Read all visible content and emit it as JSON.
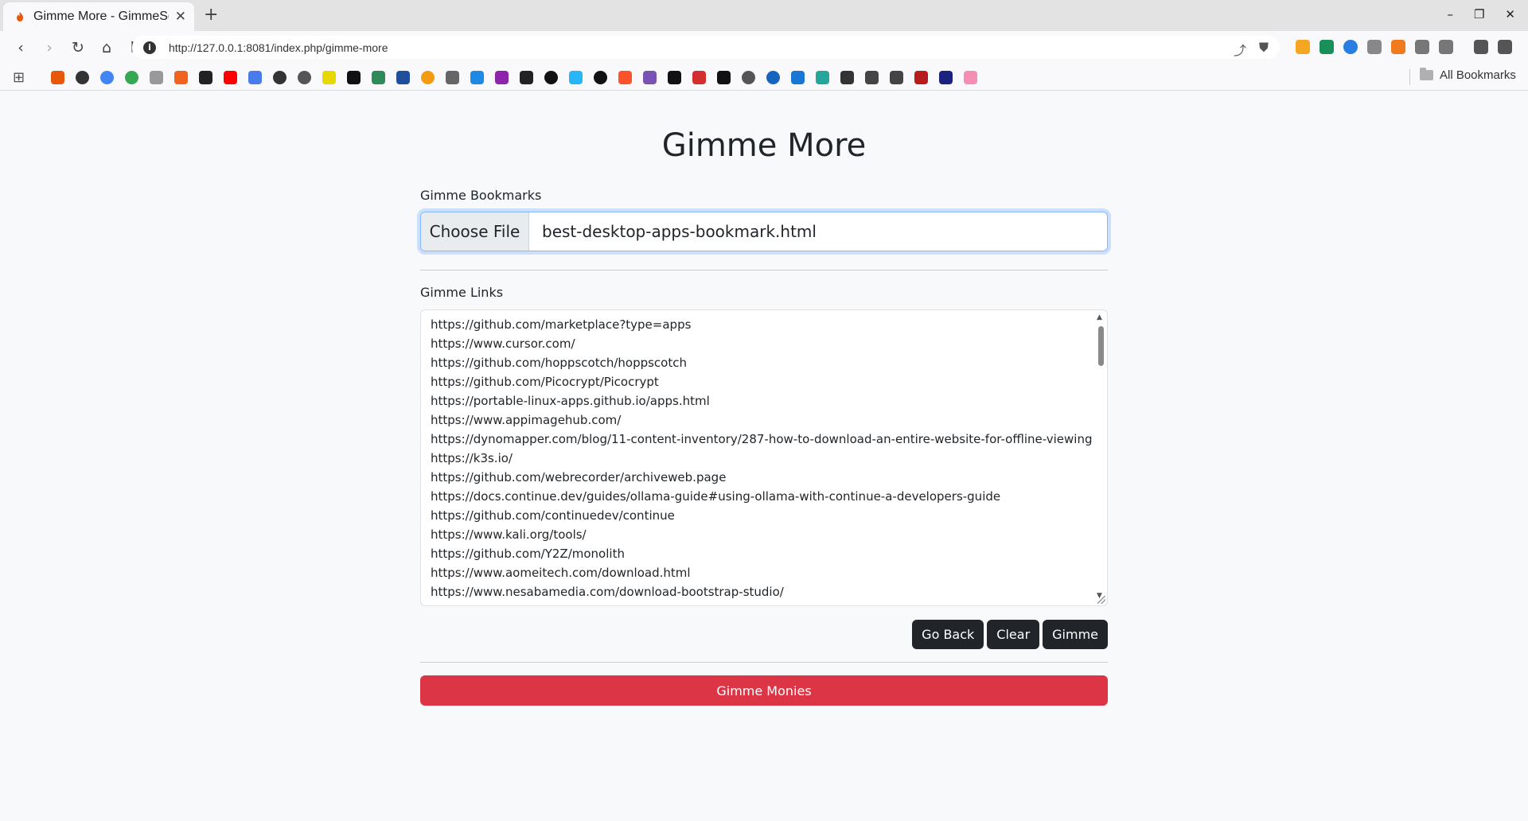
{
  "browser": {
    "tab_title": "Gimme More - GimmeSea",
    "url": "http://127.0.0.1:8081/index.php/gimme-more",
    "all_bookmarks_label": "All Bookmarks"
  },
  "colors": {
    "accent": "#86b7fe",
    "dark_button": "#212529",
    "danger_button": "#dc3545"
  },
  "page": {
    "title": "Gimme More",
    "bookmarks_label": "Gimme Bookmarks",
    "choose_file_label": "Choose File",
    "file_name": "best-desktop-apps-bookmark.html",
    "links_label": "Gimme Links",
    "links": [
      "https://github.com/marketplace?type=apps",
      "https://www.cursor.com/",
      "https://github.com/hoppscotch/hoppscotch",
      "https://github.com/Picocrypt/Picocrypt",
      "https://portable-linux-apps.github.io/apps.html",
      "https://www.appimagehub.com/",
      "https://dynomapper.com/blog/11-content-inventory/287-how-to-download-an-entire-website-for-offline-viewing",
      "https://k3s.io/",
      "https://github.com/webrecorder/archiveweb.page",
      "https://docs.continue.dev/guides/ollama-guide#using-ollama-with-continue-a-developers-guide",
      "https://github.com/continuedev/continue",
      "https://www.kali.org/tools/",
      "https://github.com/Y2Z/monolith",
      "https://www.aomeitech.com/download.html",
      "https://www.nesabamedia.com/download-bootstrap-studio/"
    ],
    "go_back_label": "Go Back",
    "clear_label": "Clear",
    "gimme_label": "Gimme",
    "monies_label": "Gimme Monies"
  }
}
